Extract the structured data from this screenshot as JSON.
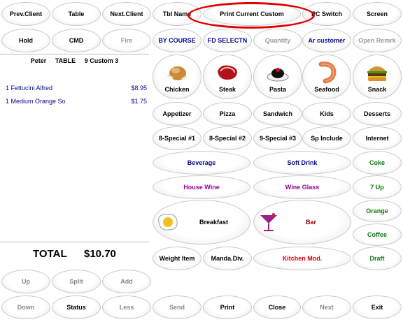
{
  "top_row": {
    "prev_client": "Prev.Client",
    "table": "Table",
    "next_client": "Next.Client",
    "tbl_name": "Tbl Name",
    "print_current_custom": "Print Current Custom",
    "pc_switch": "PC Switch",
    "screen": "Screen"
  },
  "second_row": {
    "hold": "Hold",
    "cmd": "CMD",
    "fire": "Fire",
    "by_course": "BY COURSE",
    "fd_selectn": "FD SELECTN",
    "quantity": "Quantity",
    "ar_customer": "Ar customer",
    "open_remrk": "Open Remrk"
  },
  "order": {
    "server": "Peter",
    "table_label": "TABLE",
    "table_info": "9 Custom  3",
    "items": [
      {
        "name": "1 Fettucini Alfred",
        "price": "$8.95"
      },
      {
        "name": "1 Medium Orange So",
        "price": "$1.75"
      }
    ],
    "total_label": "TOTAL",
    "total_value": "$10.70"
  },
  "categories": {
    "chicken": "Chicken",
    "steak": "Steak",
    "pasta": "Pasta",
    "seafood": "Seafood",
    "snack": "Snack",
    "appetizer": "Appetizer",
    "pizza": "Pizza",
    "sandwich": "Sandwich",
    "kids": "Kids",
    "desserts": "Desserts",
    "special1": "8-Special #1",
    "special2": "8-Special #2",
    "special3": "9-Special #3",
    "sp_include": "Sp Include",
    "internet": "Internet",
    "beverage": "Beverage",
    "soft_drink": "Soft Drink",
    "coke": "Coke",
    "house_wine": "House Wine",
    "wine_glass": "Wine Glass",
    "seven_up": "7 Up",
    "orange": "Orange",
    "breakfast": "Breakfast",
    "bar": "Bar",
    "coffee": "Coffee",
    "weight_item": "Weight Item",
    "manda_div": "Manda.Div.",
    "kitchen_mod": "Kitchen Mod.",
    "draft": "Draft"
  },
  "bottom": {
    "up": "Up",
    "split": "Split",
    "add": "Add",
    "down": "Down",
    "status": "Status",
    "less": "Less",
    "send": "Send",
    "print": "Print",
    "close": "Close",
    "next": "Next",
    "exit": "Exit"
  },
  "icons": [
    "chicken-icon",
    "steak-icon",
    "pasta-icon",
    "shrimp-icon",
    "burger-icon",
    "fried-egg-icon",
    "cocktail-icon"
  ],
  "colors": {
    "highlight_circle": "#e00000",
    "blue_text": "#0a0a90",
    "green_text": "#0a7a0a",
    "purple_text": "#990099"
  }
}
